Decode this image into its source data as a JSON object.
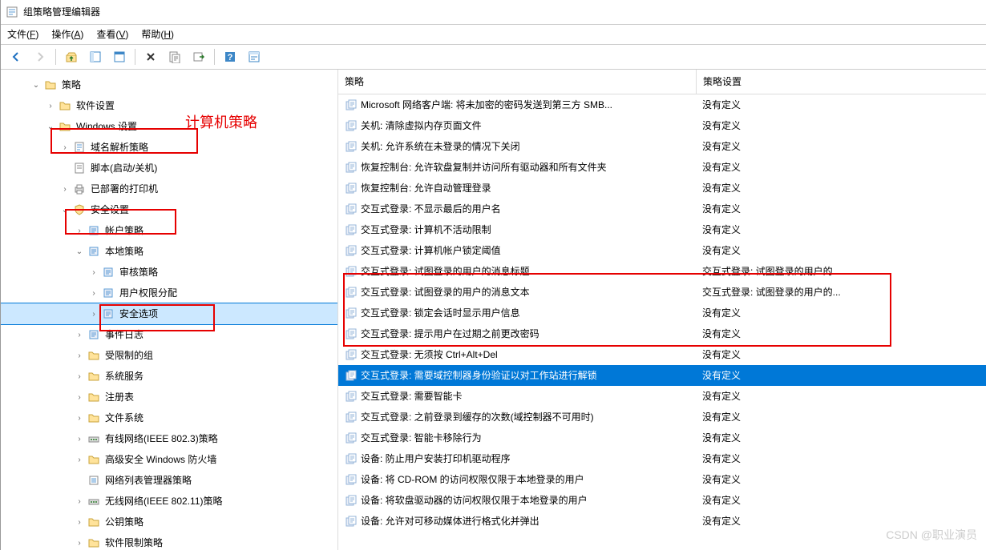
{
  "window": {
    "title": "组策略管理编辑器"
  },
  "menu": [
    {
      "label": "文件",
      "key": "F"
    },
    {
      "label": "操作",
      "key": "A"
    },
    {
      "label": "查看",
      "key": "V"
    },
    {
      "label": "帮助",
      "key": "H"
    }
  ],
  "annotation_text": "计算机策略",
  "tree": [
    {
      "indent": 2,
      "exp": "v",
      "icon": "folder",
      "label": "策略"
    },
    {
      "indent": 3,
      "exp": ">",
      "icon": "folder",
      "label": "软件设置"
    },
    {
      "indent": 3,
      "exp": "v",
      "icon": "folder",
      "label": "Windows 设置",
      "hl": true
    },
    {
      "indent": 4,
      "exp": ">",
      "icon": "doc",
      "label": "域名解析策略"
    },
    {
      "indent": 4,
      "exp": "",
      "icon": "script",
      "label": "脚本(启动/关机)"
    },
    {
      "indent": 4,
      "exp": ">",
      "icon": "printer",
      "label": "已部署的打印机"
    },
    {
      "indent": 4,
      "exp": "v",
      "icon": "shield",
      "label": "安全设置",
      "hl": true
    },
    {
      "indent": 5,
      "exp": ">",
      "icon": "policy",
      "label": "帐户策略"
    },
    {
      "indent": 5,
      "exp": "v",
      "icon": "policy",
      "label": "本地策略"
    },
    {
      "indent": 6,
      "exp": ">",
      "icon": "policy",
      "label": "审核策略"
    },
    {
      "indent": 6,
      "exp": ">",
      "icon": "policy",
      "label": "用户权限分配"
    },
    {
      "indent": 6,
      "exp": ">",
      "icon": "policy",
      "label": "安全选项",
      "hl": true,
      "sel": true
    },
    {
      "indent": 5,
      "exp": ">",
      "icon": "policy",
      "label": "事件日志"
    },
    {
      "indent": 5,
      "exp": ">",
      "icon": "folder",
      "label": "受限制的组"
    },
    {
      "indent": 5,
      "exp": ">",
      "icon": "folder",
      "label": "系统服务"
    },
    {
      "indent": 5,
      "exp": ">",
      "icon": "folder",
      "label": "注册表"
    },
    {
      "indent": 5,
      "exp": ">",
      "icon": "folder",
      "label": "文件系统"
    },
    {
      "indent": 5,
      "exp": ">",
      "icon": "net",
      "label": "有线网络(IEEE 802.3)策略"
    },
    {
      "indent": 5,
      "exp": ">",
      "icon": "folder-fw",
      "label": "高级安全 Windows 防火墙"
    },
    {
      "indent": 5,
      "exp": "",
      "icon": "list",
      "label": "网络列表管理器策略"
    },
    {
      "indent": 5,
      "exp": ">",
      "icon": "net",
      "label": "无线网络(IEEE 802.11)策略"
    },
    {
      "indent": 5,
      "exp": ">",
      "icon": "folder",
      "label": "公钥策略"
    },
    {
      "indent": 5,
      "exp": ">",
      "icon": "folder",
      "label": "软件限制策略"
    }
  ],
  "list_header": {
    "policy": "策略",
    "setting": "策略设置"
  },
  "policies": [
    {
      "policy": "Microsoft 网络客户端: 将未加密的密码发送到第三方 SMB...",
      "setting": "没有定义"
    },
    {
      "policy": "关机: 清除虚拟内存页面文件",
      "setting": "没有定义"
    },
    {
      "policy": "关机: 允许系统在未登录的情况下关闭",
      "setting": "没有定义"
    },
    {
      "policy": "恢复控制台: 允许软盘复制并访问所有驱动器和所有文件夹",
      "setting": "没有定义"
    },
    {
      "policy": "恢复控制台: 允许自动管理登录",
      "setting": "没有定义"
    },
    {
      "policy": "交互式登录: 不显示最后的用户名",
      "setting": "没有定义"
    },
    {
      "policy": "交互式登录: 计算机不活动限制",
      "setting": "没有定义"
    },
    {
      "policy": "交互式登录: 计算机帐户锁定阈值",
      "setting": "没有定义"
    },
    {
      "policy": "交互式登录: 试图登录的用户的消息标题",
      "setting": "交互式登录: 试图登录的用户的..."
    },
    {
      "policy": "交互式登录: 试图登录的用户的消息文本",
      "setting": "交互式登录: 试图登录的用户的..."
    },
    {
      "policy": "交互式登录: 锁定会话时显示用户信息",
      "setting": "没有定义"
    },
    {
      "policy": "交互式登录: 提示用户在过期之前更改密码",
      "setting": "没有定义"
    },
    {
      "policy": "交互式登录: 无须按 Ctrl+Alt+Del",
      "setting": "没有定义"
    },
    {
      "policy": "交互式登录: 需要域控制器身份验证以对工作站进行解锁",
      "setting": "没有定义",
      "selected": true
    },
    {
      "policy": "交互式登录: 需要智能卡",
      "setting": "没有定义"
    },
    {
      "policy": "交互式登录: 之前登录到缓存的次数(域控制器不可用时)",
      "setting": "没有定义"
    },
    {
      "policy": "交互式登录: 智能卡移除行为",
      "setting": "没有定义"
    },
    {
      "policy": "设备: 防止用户安装打印机驱动程序",
      "setting": "没有定义"
    },
    {
      "policy": "设备: 将 CD-ROM 的访问权限仅限于本地登录的用户",
      "setting": "没有定义"
    },
    {
      "policy": "设备: 将软盘驱动器的访问权限仅限于本地登录的用户",
      "setting": "没有定义"
    },
    {
      "policy": "设备: 允许对可移动媒体进行格式化并弹出",
      "setting": "没有定义"
    }
  ],
  "watermark": "CSDN @职业演员"
}
